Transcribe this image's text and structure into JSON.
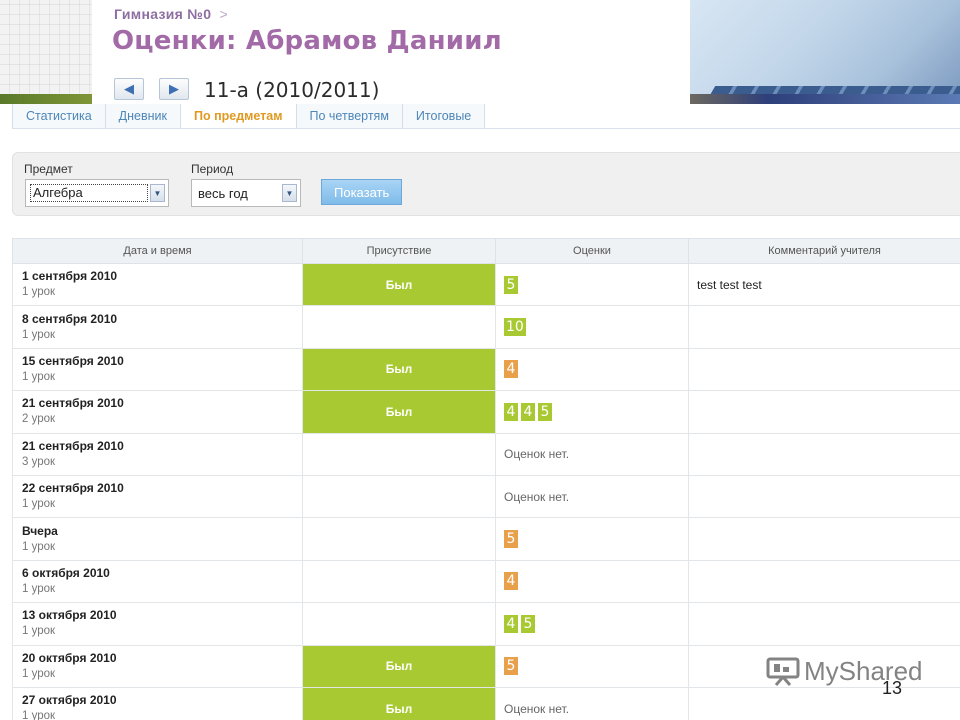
{
  "header": {
    "breadcrumb": "Гимназия №0",
    "breadcrumb_sep": ">",
    "title": "Оценки: Абрамов Даниил",
    "class_period": "11-а (2010/2011)"
  },
  "tabs": [
    {
      "label": "Статистика",
      "active": false
    },
    {
      "label": "Дневник",
      "active": false
    },
    {
      "label": "По предметам",
      "active": true
    },
    {
      "label": "По четвертям",
      "active": false
    },
    {
      "label": "Итоговые",
      "active": false
    }
  ],
  "filters": {
    "subject_label": "Предмет",
    "subject_value": "Алгебра",
    "period_label": "Период",
    "period_value": "весь год",
    "show_button": "Показать"
  },
  "table": {
    "columns": [
      "Дата и время",
      "Присутствие",
      "Оценки",
      "Комментарий учителя"
    ],
    "rows": [
      {
        "date": "1 сентября 2010",
        "lesson": "1 урок",
        "attendance": "Был",
        "grades": [
          {
            "v": "5",
            "c": "g"
          }
        ],
        "comment": "test test test"
      },
      {
        "date": "8 сентября 2010",
        "lesson": "1 урок",
        "attendance": "",
        "grades": [
          {
            "v": "10",
            "c": "g"
          }
        ],
        "comment": ""
      },
      {
        "date": "15 сентября 2010",
        "lesson": "1 урок",
        "attendance": "Был",
        "grades": [
          {
            "v": "4",
            "c": "o"
          }
        ],
        "comment": ""
      },
      {
        "date": "21 сентября 2010",
        "lesson": "2 урок",
        "attendance": "Был",
        "grades": [
          {
            "v": "4",
            "c": "g"
          },
          {
            "v": "4",
            "c": "g"
          },
          {
            "v": "5",
            "c": "g"
          }
        ],
        "comment": ""
      },
      {
        "date": "21 сентября 2010",
        "lesson": "3 урок",
        "attendance": "",
        "grades": [],
        "comment": ""
      },
      {
        "date": "22 сентября 2010",
        "lesson": "1 урок",
        "attendance": "",
        "grades": [],
        "comment": ""
      },
      {
        "date": "Вчера",
        "lesson": "1 урок",
        "attendance": "",
        "grades": [
          {
            "v": "5",
            "c": "o"
          }
        ],
        "comment": ""
      },
      {
        "date": "6 октября 2010",
        "lesson": "1 урок",
        "attendance": "",
        "grades": [
          {
            "v": "4",
            "c": "o"
          }
        ],
        "comment": ""
      },
      {
        "date": "13 октября 2010",
        "lesson": "1 урок",
        "attendance": "",
        "grades": [
          {
            "v": "4",
            "c": "g"
          },
          {
            "v": "5",
            "c": "g"
          }
        ],
        "comment": ""
      },
      {
        "date": "20 октября 2010",
        "lesson": "1 урок",
        "attendance": "Был",
        "grades": [
          {
            "v": "5",
            "c": "o"
          }
        ],
        "comment": ""
      },
      {
        "date": "27 октября 2010",
        "lesson": "1 урок",
        "attendance": "Был",
        "grades": [],
        "comment": ""
      }
    ],
    "no_grades_text": "Оценок нет."
  },
  "colors": {
    "present": "#a8c932",
    "grade_green": "#a8c932",
    "grade_orange": "#e8a04a",
    "title": "#a36aa8",
    "active_tab": "#e09a22"
  },
  "icons": {
    "prev": "arrow-left-icon",
    "next": "arrow-right-icon",
    "dropdown": "chevron-down-icon"
  },
  "watermark": "MyShared",
  "slide_number": "13"
}
